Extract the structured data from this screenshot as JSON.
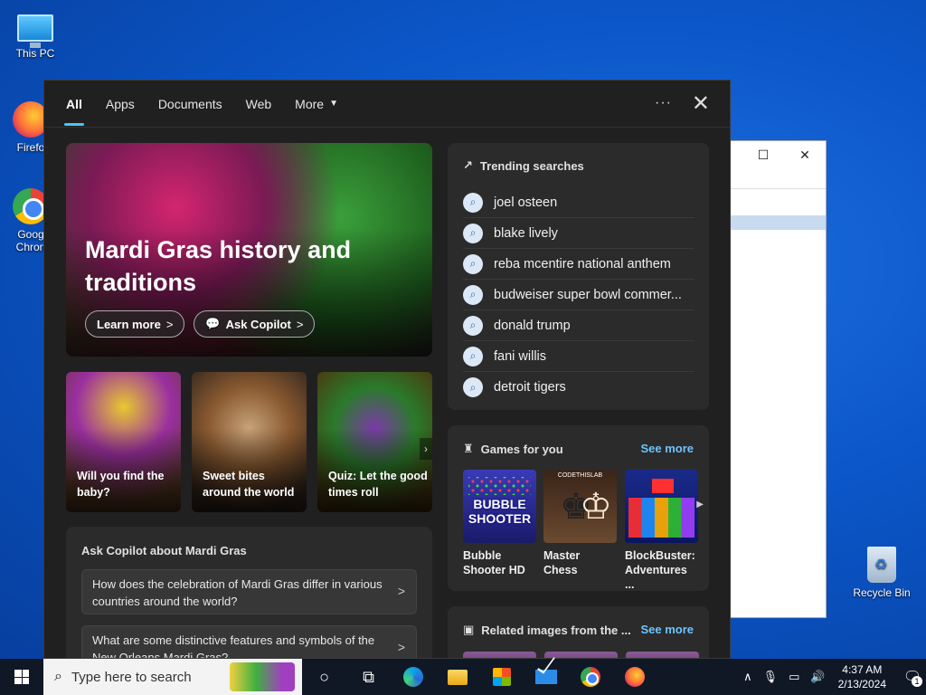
{
  "desktop": {
    "icons": [
      {
        "label": "This PC"
      },
      {
        "label": "Firefo"
      },
      {
        "label": "Goog",
        "label2": "Chron"
      },
      {
        "label": "Recycle Bin"
      }
    ]
  },
  "search_panel": {
    "tabs": [
      {
        "label": "All",
        "active": true
      },
      {
        "label": "Apps"
      },
      {
        "label": "Documents"
      },
      {
        "label": "Web"
      },
      {
        "label": "More"
      }
    ],
    "more_options": "···",
    "close": "✕",
    "hero": {
      "title": "Mardi Gras history and traditions",
      "learn_more": "Learn more",
      "ask_copilot": "Ask Copilot"
    },
    "cards": [
      {
        "caption": "Will you find the baby?"
      },
      {
        "caption": "Sweet bites around the world"
      },
      {
        "caption": "Quiz: Let the good times roll"
      }
    ],
    "copilot": {
      "heading": "Ask Copilot about Mardi Gras",
      "questions": [
        "How does the celebration of Mardi Gras differ in various countries around the world?",
        "What are some distinctive features and symbols of the New Orleans Mardi Gras?"
      ]
    },
    "trending": {
      "heading": "Trending searches",
      "items": [
        "joel osteen",
        "blake lively",
        "reba mcentire national anthem",
        "budweiser super bowl commer...",
        "donald trump",
        "fani willis",
        "detroit tigers"
      ]
    },
    "games": {
      "heading": "Games for you",
      "see_more": "See more",
      "items": [
        {
          "name": "Bubble Shooter HD",
          "tile_text": "BUBBLE SHOOTER"
        },
        {
          "name": "Master Chess",
          "tile_text": "CODETHISLAB"
        },
        {
          "name": "BlockBuster: Adventures ..."
        }
      ]
    },
    "related": {
      "heading": "Related images from the ...",
      "see_more": "See more"
    }
  },
  "taskbar": {
    "search_placeholder": "Type here to search",
    "clock_time": "4:37 AM",
    "clock_date": "2/13/2024",
    "notification_count": "1"
  }
}
